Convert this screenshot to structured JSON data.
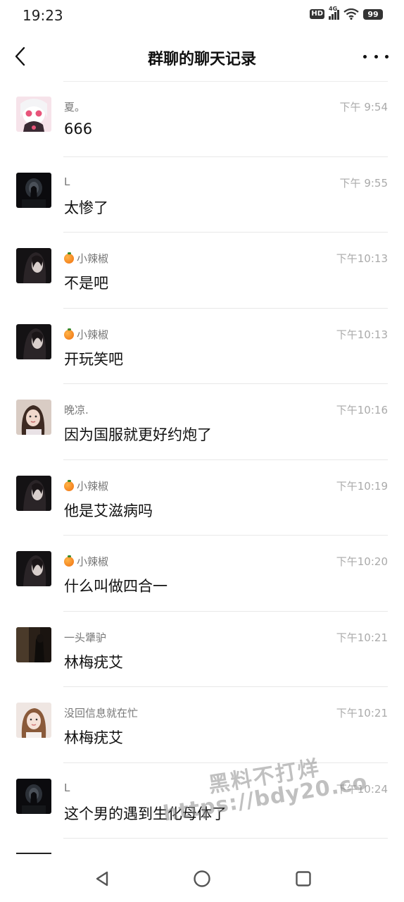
{
  "status_bar": {
    "time": "19:23",
    "hd_label": "HD",
    "network": "4G",
    "battery": "99"
  },
  "header": {
    "title": "群聊的聊天记录"
  },
  "messages": [
    {
      "sender": "夏。",
      "time": "下午 9:54",
      "text": "666",
      "orange": false,
      "avatar": "anime-avatar"
    },
    {
      "sender": "L",
      "time": "下午 9:55",
      "text": "太惨了",
      "orange": false,
      "avatar": "dark-tunnel-avatar"
    },
    {
      "sender": "小辣椒",
      "time": "下午10:13",
      "text": "不是吧",
      "orange": true,
      "avatar": "dark-portrait-avatar"
    },
    {
      "sender": "小辣椒",
      "time": "下午10:13",
      "text": "开玩笑吧",
      "orange": true,
      "avatar": "dark-portrait-avatar"
    },
    {
      "sender": "晚凉.",
      "time": "下午10:16",
      "text": "因为国服就更好约炮了",
      "orange": false,
      "avatar": "girl-photo-avatar"
    },
    {
      "sender": "小辣椒",
      "time": "下午10:19",
      "text": "他是艾滋病吗",
      "orange": true,
      "avatar": "dark-portrait-avatar"
    },
    {
      "sender": "小辣椒",
      "time": "下午10:20",
      "text": "什么叫做四合一",
      "orange": true,
      "avatar": "dark-portrait-avatar"
    },
    {
      "sender": "一头犟驴",
      "time": "下午10:21",
      "text": "林梅疣艾",
      "orange": false,
      "avatar": "dark-room-avatar"
    },
    {
      "sender": "没回信息就在忙",
      "time": "下午10:21",
      "text": "林梅疣艾",
      "orange": false,
      "avatar": "girl-light-avatar"
    },
    {
      "sender": "L",
      "time": "下午10:24",
      "text": "这个男的遇到生化母体了",
      "orange": false,
      "avatar": "dark-tunnel-avatar"
    }
  ],
  "watermark": {
    "line1": "黑料不打烊",
    "line2": "https://bdy20.co"
  },
  "colors": {
    "sender": "#777777",
    "time": "#aaaaaa",
    "divider": "#e8e8e8",
    "orange": "#f07010"
  }
}
